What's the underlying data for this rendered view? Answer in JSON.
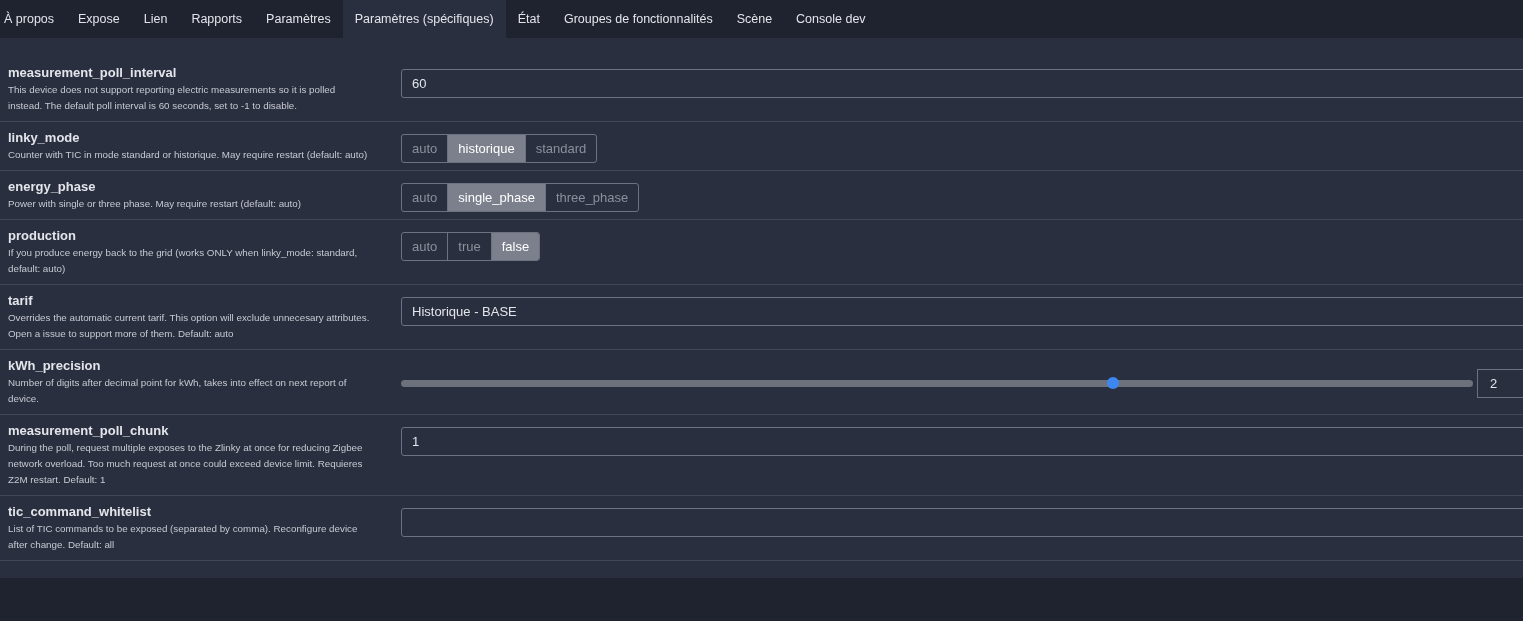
{
  "tabs": [
    {
      "label": "À propos",
      "selected": false
    },
    {
      "label": "Expose",
      "selected": false
    },
    {
      "label": "Lien",
      "selected": false
    },
    {
      "label": "Rapports",
      "selected": false
    },
    {
      "label": "Paramètres",
      "selected": false
    },
    {
      "label": "Paramètres (spécifiques)",
      "selected": true
    },
    {
      "label": "État",
      "selected": false
    },
    {
      "label": "Groupes de fonctionnalités",
      "selected": false
    },
    {
      "label": "Scène",
      "selected": false
    },
    {
      "label": "Console dev",
      "selected": false
    }
  ],
  "settings": [
    {
      "kind": "field",
      "name": "measurement_poll_interval",
      "description": "This device does not support reporting electric measurements so it is polled instead. The default poll interval is 60 seconds, set to -1 to disable.",
      "value": "60"
    },
    {
      "kind": "toggle",
      "name": "linky_mode",
      "description": "Counter with TIC in mode standard or historique. May require restart (default: auto)",
      "options": [
        {
          "label": "auto",
          "selected": false
        },
        {
          "label": "historique",
          "selected": true
        },
        {
          "label": "standard",
          "selected": false
        }
      ]
    },
    {
      "kind": "toggle",
      "name": "energy_phase",
      "description": "Power with single or three phase. May require restart (default: auto)",
      "options": [
        {
          "label": "auto",
          "selected": false
        },
        {
          "label": "single_phase",
          "selected": true
        },
        {
          "label": "three_phase",
          "selected": false
        }
      ]
    },
    {
      "kind": "toggle",
      "name": "production",
      "description": "If you produce energy back to the grid (works ONLY when linky_mode: standard, default: auto)",
      "options": [
        {
          "label": "auto",
          "selected": false
        },
        {
          "label": "true",
          "selected": false
        },
        {
          "label": "false",
          "selected": true
        }
      ]
    },
    {
      "kind": "select",
      "name": "tarif",
      "description": "Overrides the automatic current tarif. This option will exclude unnecesary attributes. Open a issue to support more of them. Default: auto",
      "value": "Historique - BASE"
    },
    {
      "kind": "slider",
      "name": "kWh_precision",
      "description": "Number of digits after decimal point for kWh, takes into effect on next report of device.",
      "level": 0.664,
      "value": "2"
    },
    {
      "kind": "field",
      "name": "measurement_poll_chunk",
      "description": "During the poll, request multiple exposes to the Zlinky at once for reducing Zigbee network overload. Too much request at once could exceed device limit. Requieres Z2M restart. Default: 1",
      "value": "1"
    },
    {
      "kind": "field",
      "name": "tic_command_whitelist",
      "description": "List of TIC commands to be exposed (separated by comma). Reconfigure device after change. Default: all"
    }
  ]
}
